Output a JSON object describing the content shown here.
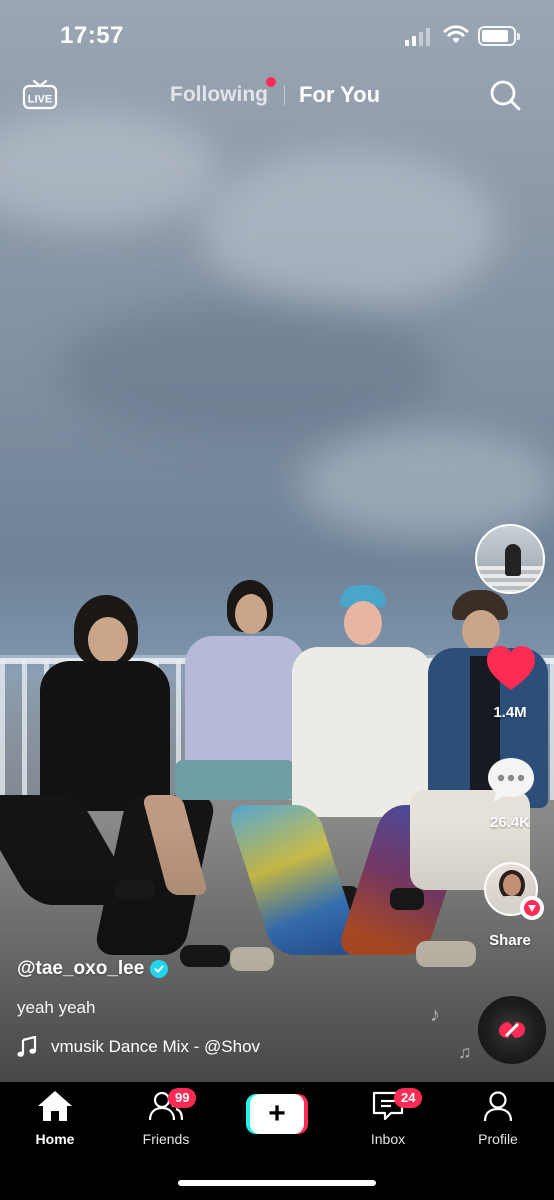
{
  "status_bar": {
    "time": "17:57"
  },
  "top_nav": {
    "live_icon": "live-tv-icon",
    "live_label": "LIVE",
    "tabs": [
      {
        "label": "Following",
        "has_dot": true
      },
      {
        "label": "For You",
        "active": true
      }
    ],
    "search_icon": "search-icon"
  },
  "video": {
    "username": "@tae_oxo_lee",
    "verified": true,
    "caption": "yeah yeah",
    "music": "vmusik Dance Mix - @Shov"
  },
  "actions": {
    "like_count": "1.4M",
    "comment_count": "26.4K",
    "share_label": "Share"
  },
  "tab_bar": {
    "home": "Home",
    "friends": "Friends",
    "friends_badge": "99",
    "create_icon": "+",
    "inbox": "Inbox",
    "inbox_badge": "24",
    "profile": "Profile"
  },
  "colors": {
    "accent": "#fe2c55",
    "cyan": "#25f4ee",
    "verified": "#20d5ec"
  }
}
